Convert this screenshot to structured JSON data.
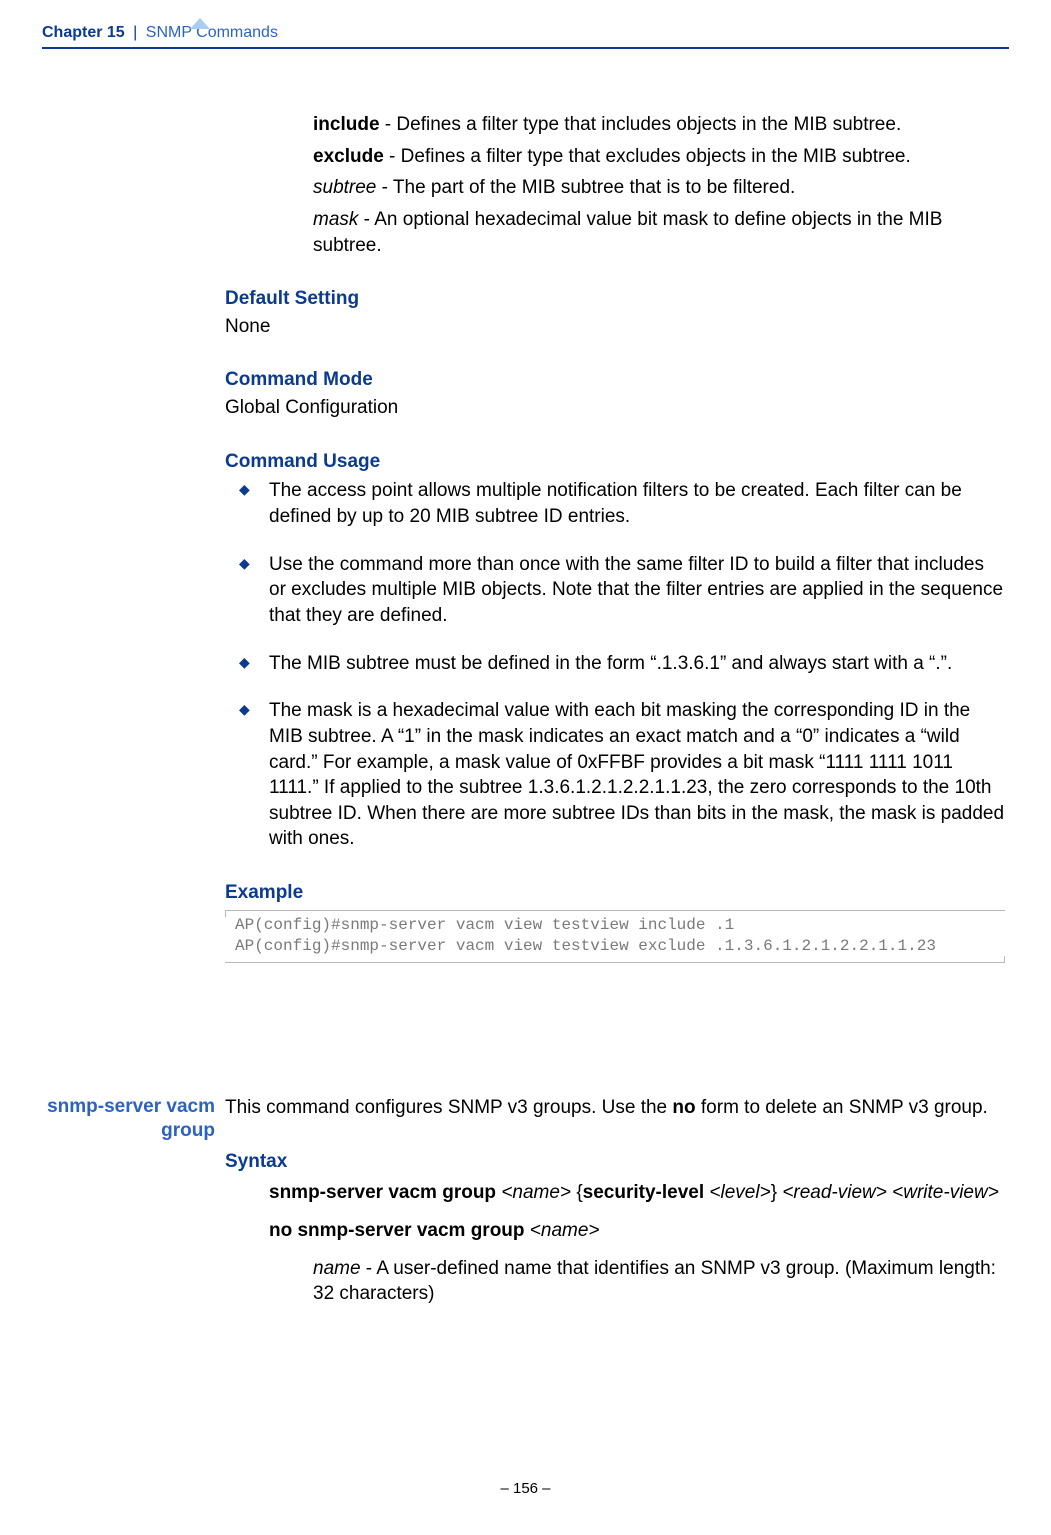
{
  "header": {
    "chapter": "Chapter 15",
    "sep": "|",
    "title": "SNMP Commands"
  },
  "prev": {
    "include_label": "include",
    "include_text": " - Defines a filter type that includes objects in the MIB subtree.",
    "exclude_label": "exclude",
    "exclude_text": " - Defines a filter type that excludes objects in the MIB subtree.",
    "subtree_label": "subtree",
    "subtree_text": " - The part of the MIB subtree that is to be filtered.",
    "mask_label": "mask",
    "mask_text": " - An optional hexadecimal value bit mask to define objects in the MIB subtree."
  },
  "default": {
    "head": "Default Setting",
    "body": "None"
  },
  "mode": {
    "head": "Command Mode",
    "body": "Global Configuration"
  },
  "usage": {
    "head": "Command Usage",
    "items": [
      "The access point allows multiple notification filters to be created. Each filter can be defined by up to 20 MIB subtree ID entries.",
      "Use the command more than once with the same filter ID to build a filter that includes or excludes multiple MIB objects. Note that the filter entries are applied in the sequence that they are defined.",
      "The MIB subtree must be defined in the form “.1.3.6.1” and always start with a “.”.",
      "The mask is a hexadecimal value with each bit masking the corresponding ID in the MIB subtree. A “1” in the mask indicates an exact match and a “0” indicates a “wild card.” For example, a mask value of 0xFFBF provides a bit mask “1111 1111 1011 1111.” If applied to the subtree 1.3.6.1.2.1.2.2.1.1.23, the zero corresponds to the 10th subtree ID. When there are more subtree IDs than bits in the mask, the mask is padded with ones."
    ]
  },
  "example": {
    "head": "Example",
    "code": "AP(config)#snmp-server vacm view testview include .1\nAP(config)#snmp-server vacm view testview exclude .1.3.6.1.2.1.2.2.1.1.23"
  },
  "side": {
    "line1": "snmp-server vacm",
    "line2": "group"
  },
  "group": {
    "desc_a": "This command configures SNMP v3 groups. Use the ",
    "desc_no": "no",
    "desc_b": " form to delete an SNMP v3 group.",
    "syntax_head": "Syntax",
    "syn1_a": "snmp-server vacm group ",
    "syn1_name": "<name>",
    "syn1_brace_open": " {",
    "syn1_sec": "security-level",
    "syn1_level": " <level>",
    "syn1_brace_close": "} ",
    "syn1_read": "<read-view>",
    "syn1_write": "<write-view>",
    "syn2_a": "no snmp-server vacm group ",
    "syn2_name": "<name>",
    "param_name_label": "name",
    "param_name_text": " - A user-defined name that identifies an SNMP v3 group. (Maximum length: 32 characters)"
  },
  "footer": {
    "text": "–  156  –"
  }
}
